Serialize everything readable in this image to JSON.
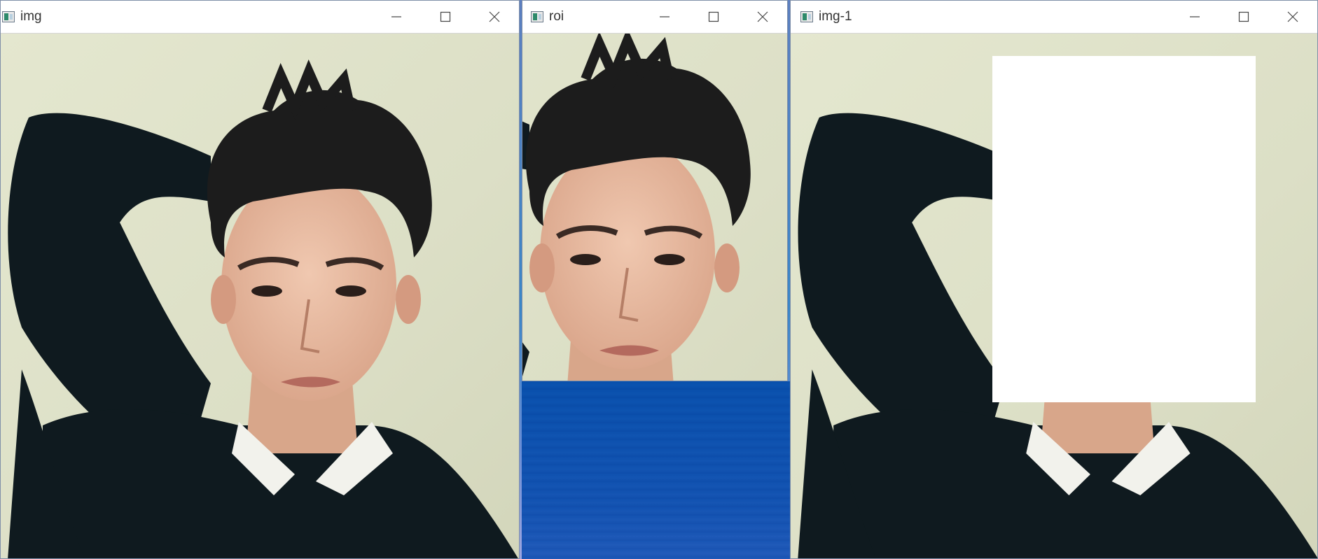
{
  "windows": [
    {
      "title": "img",
      "icon": "opencv-window-icon"
    },
    {
      "title": "roi",
      "icon": "opencv-window-icon"
    },
    {
      "title": "img-1",
      "icon": "opencv-window-icon"
    }
  ],
  "controls": {
    "minimize": "minimize-icon",
    "maximize": "maximize-icon",
    "close": "close-icon"
  },
  "colors": {
    "wall": "#dfe3c8",
    "sweater": "#0f1a1f",
    "skin": "#e6b79e",
    "hair": "#1c1c1c",
    "mask": "#ffffff",
    "desktop_blue": "#3a8bd0"
  }
}
